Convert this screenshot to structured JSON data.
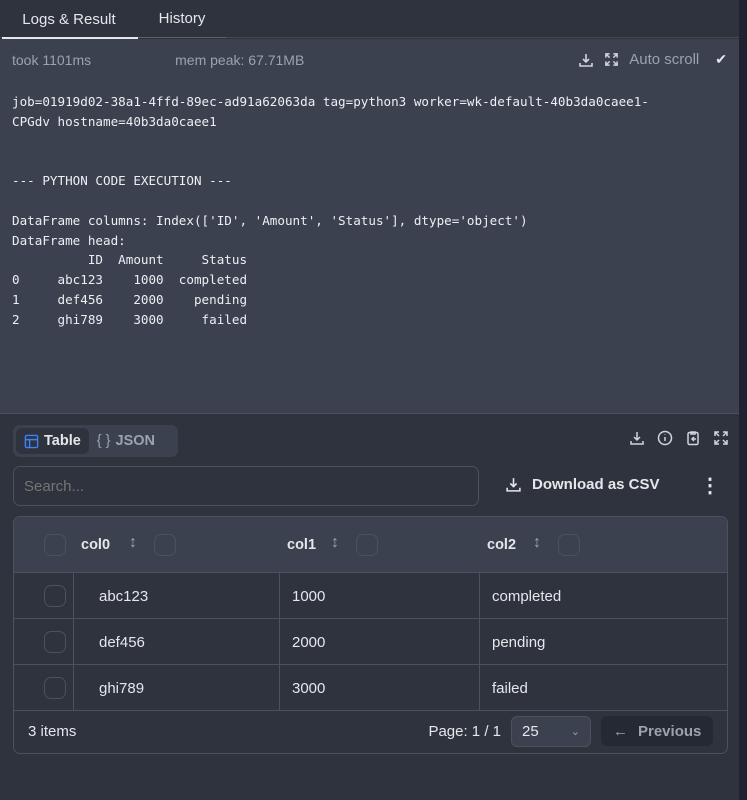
{
  "tabs": [
    "Logs & Result",
    "History"
  ],
  "stats": {
    "took": "took 1101ms",
    "mem": "mem peak: 67.71MB",
    "auto_scroll": "Auto scroll",
    "check": "✔"
  },
  "log": "job=01919d02-38a1-4ffd-89ec-ad91a62063da tag=python3 worker=wk-default-40b3da0caee1-\nCPGdv hostname=40b3da0caee1\n\n\n--- PYTHON CODE EXECUTION ---\n\nDataFrame columns: Index(['ID', 'Amount', 'Status'], dtype='object')\nDataFrame head:\n          ID  Amount     Status\n0     abc123    1000  completed\n1     def456    2000    pending\n2     ghi789    3000     failed",
  "view": {
    "table": "Table",
    "json": "JSON",
    "json_glyph": "{ }"
  },
  "search": {
    "placeholder": "Search..."
  },
  "download_csv": "Download as CSV",
  "more": "⋮",
  "columns": [
    "col0",
    "col1",
    "col2"
  ],
  "rows": [
    [
      "abc123",
      "1000",
      "completed"
    ],
    [
      "def456",
      "2000",
      "pending"
    ],
    [
      "ghi789",
      "3000",
      "failed"
    ]
  ],
  "footer": {
    "items": "3 items",
    "page": "Page: 1 / 1",
    "page_size": "25",
    "previous": "Previous"
  }
}
